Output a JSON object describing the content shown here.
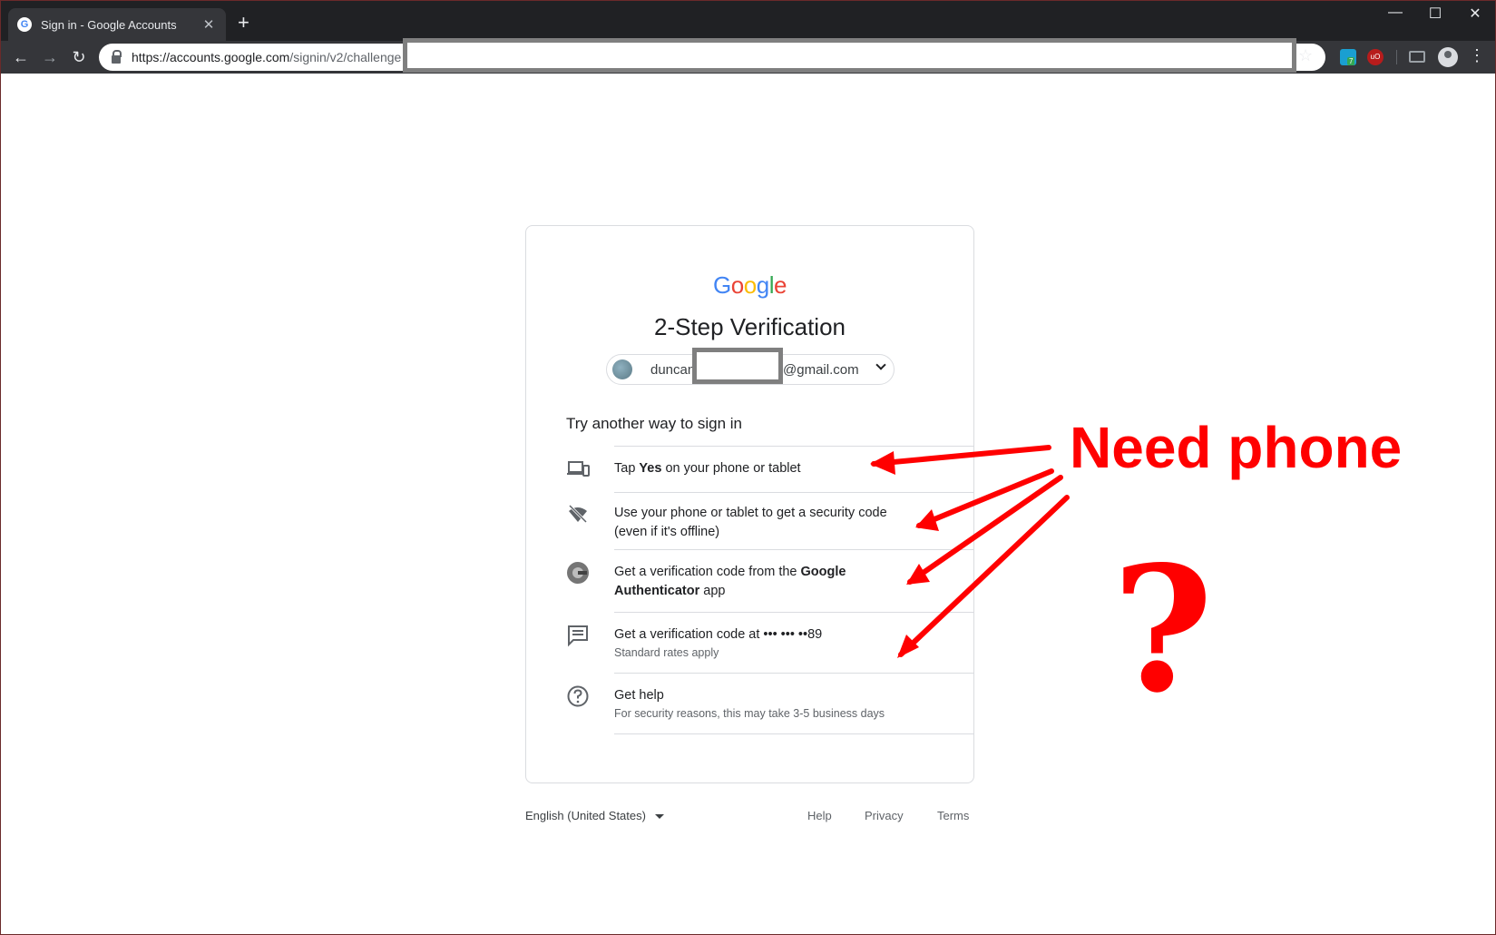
{
  "browser": {
    "tab_title": "Sign in - Google Accounts",
    "favicon_letter": "G",
    "close_glyph": "✕",
    "new_tab_glyph": "+",
    "minimize_glyph": "—",
    "maximize_glyph": "☐",
    "window_close_glyph": "✕",
    "back_glyph": "←",
    "forward_glyph": "→",
    "reload_glyph": "↻",
    "url_host": "https://accounts.google.com",
    "url_path": "/signin/v2/challenge",
    "star_glyph": "☆",
    "menu_glyph": "⋮",
    "ext_badge": "7",
    "ext2_label": "uO"
  },
  "card": {
    "logo_letters": [
      {
        "ch": "G",
        "color": "#4285F4"
      },
      {
        "ch": "o",
        "color": "#EA4335"
      },
      {
        "ch": "o",
        "color": "#FBBC05"
      },
      {
        "ch": "g",
        "color": "#4285F4"
      },
      {
        "ch": "l",
        "color": "#34A853"
      },
      {
        "ch": "e",
        "color": "#EA4335"
      }
    ],
    "heading": "2-Step Verification",
    "email_prefix": "duncan",
    "email_suffix": "@gmail.com",
    "subheading": "Try another way to sign in",
    "options": [
      {
        "pre": "Tap ",
        "bold": "Yes",
        "post": " on your phone or tablet",
        "icon": "devices-icon"
      },
      {
        "text_line1": "Use your phone or tablet to get a security code",
        "text_line2": "(even if it's offline)",
        "icon": "offline-key-icon"
      },
      {
        "pre": "Get a verification code from the ",
        "bold": "Google Authenticator",
        "post": " app",
        "icon": "authenticator-icon"
      },
      {
        "text": "Get a verification code at ••• ••• ••89",
        "sub": "Standard rates apply",
        "icon": "sms-icon"
      },
      {
        "text": "Get help",
        "sub": "For security reasons, this may take 3-5 business days",
        "icon": "help-icon"
      }
    ]
  },
  "footer": {
    "language": "English (United States)",
    "links": [
      "Help",
      "Privacy",
      "Terms"
    ]
  },
  "annotation": {
    "text": "Need phone",
    "question": "?",
    "color": "#ff0000"
  }
}
